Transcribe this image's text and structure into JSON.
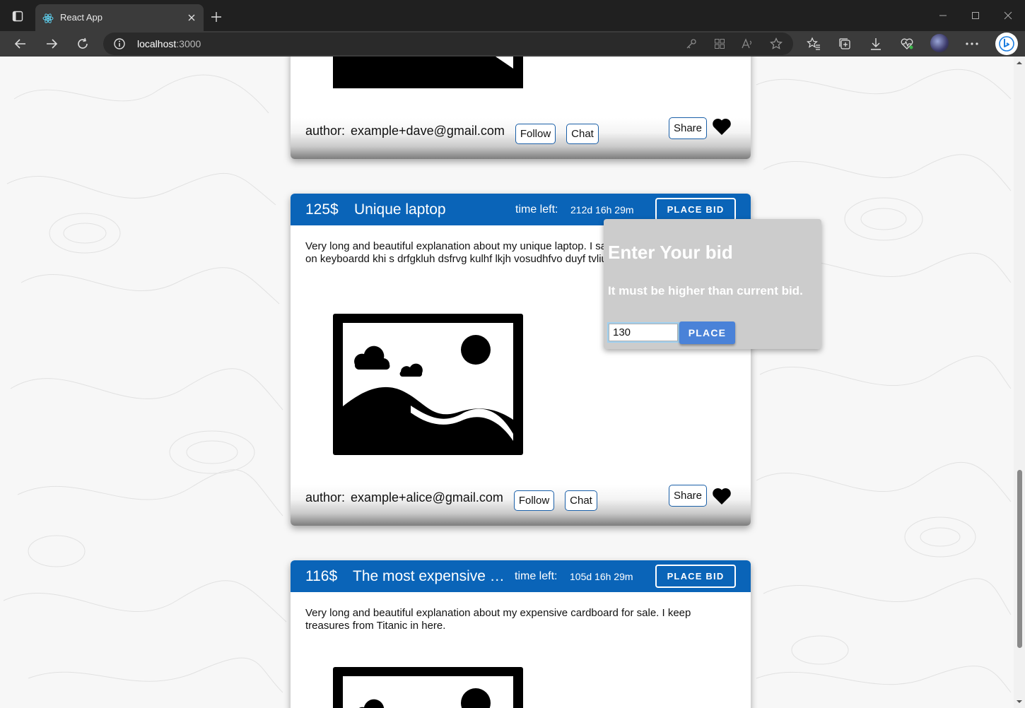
{
  "browser": {
    "tab_title": "React App",
    "address_host": "localhost",
    "address_port": ":3000"
  },
  "cards": [
    {
      "author_label": "author:",
      "author_email": "example+dave@gmail.com",
      "follow_label": "Follow",
      "chat_label": "Chat",
      "share_label": "Share"
    },
    {
      "price": "125$",
      "title": "Unique laptop",
      "time_label": "time left:",
      "time_value": "212d 16h 29m",
      "place_bid_label": "PLACE BID",
      "description": "Very long and beautiful explanation about my unique laptop. I saw my bestfriend's cat walk on keyboardd khi s drfgkluh dsfrvg kulhf lkjh vosudhfvo duyf tvliug sdrt g 87ilre54t !!!",
      "author_label": "author:",
      "author_email": "example+alice@gmail.com",
      "follow_label": "Follow",
      "chat_label": "Chat",
      "share_label": "Share"
    },
    {
      "price": "116$",
      "title": "The most expensive cardboard",
      "time_label": "time left:",
      "time_value": "105d 16h 29m",
      "place_bid_label": "PLACE BID",
      "description": "Very long and beautiful explanation about my expensive cardboard for sale. I keep treasures from Titanic in here."
    }
  ],
  "bid_popup": {
    "title": "Enter Your bid",
    "subtitle": "It must be higher than current bid.",
    "input_value": "130",
    "place_label": "PLACE"
  },
  "colors": {
    "header_blue": "#0a64b8",
    "place_button": "#4a82d8",
    "popup_bg": "#cccccc"
  }
}
